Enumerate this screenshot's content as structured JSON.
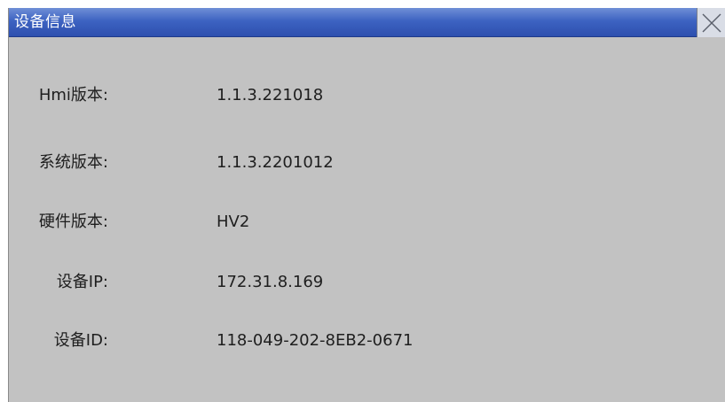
{
  "window": {
    "title": "设备信息",
    "close_icon": "close-icon"
  },
  "info": {
    "hmi_version_label": "Hmi版本:",
    "hmi_version_value": "1.1.3.221018",
    "system_version_label": "系统版本:",
    "system_version_value": "1.1.3.2201012",
    "hardware_version_label": "硬件版本:",
    "hardware_version_value": "HV2",
    "device_ip_label": "设备IP:",
    "device_ip_value": "172.31.8.169",
    "device_id_label": "设备ID:",
    "device_id_value": "118-049-202-8EB2-0671"
  },
  "colors": {
    "title_bar": "#3d63c2",
    "dialog_background": "#c2c2c2",
    "text": "#1e1e1e"
  }
}
